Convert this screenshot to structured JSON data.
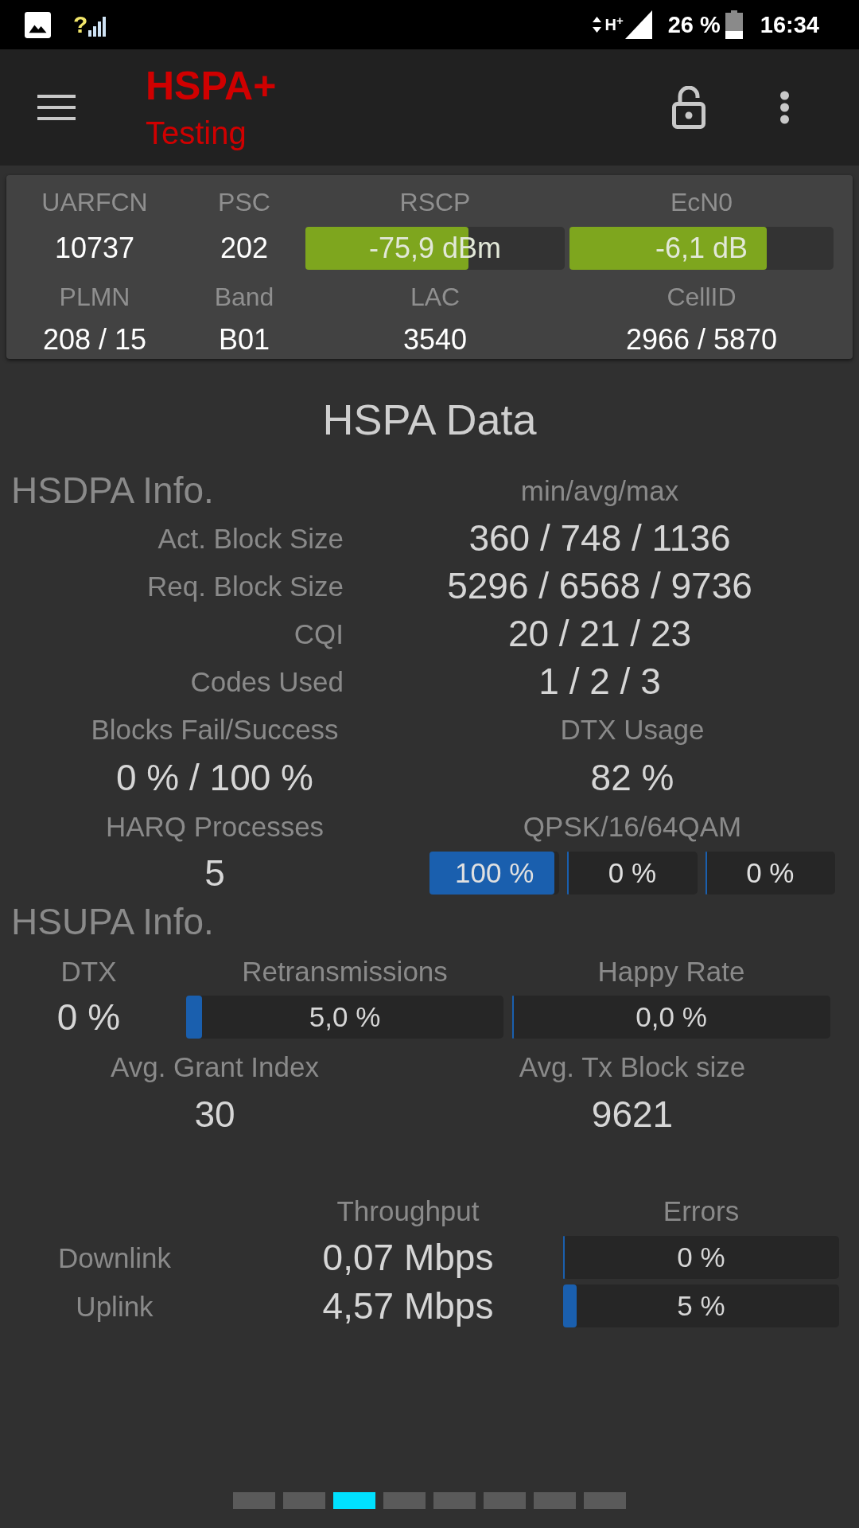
{
  "status_bar": {
    "no_sim_mark": "?",
    "network_type": "H$^{+}$",
    "battery": "26 %",
    "time": "16:34"
  },
  "app_bar": {
    "title": "HSPA+",
    "subtitle": "Testing"
  },
  "cell_info": {
    "fields": [
      {
        "label": "UARFCN",
        "value": "10737",
        "kind": "text"
      },
      {
        "label": "PSC",
        "value": "202",
        "kind": "text"
      },
      {
        "label": "RSCP",
        "value": "-75,9 dBm",
        "kind": "meter",
        "level": 0.64
      },
      {
        "label": "EcN0",
        "value": "-6,1 dB",
        "kind": "meter",
        "level": 0.76
      },
      {
        "label": "PLMN",
        "value": "208 / 15",
        "kind": "text"
      },
      {
        "label": "Band",
        "value": "B01",
        "kind": "text"
      },
      {
        "label": "LAC",
        "value": "3540",
        "kind": "text"
      },
      {
        "label": "CellID",
        "value": "2966 / 5870",
        "kind": "text"
      }
    ]
  },
  "section_title": "HSPA Data",
  "hsdpa": {
    "heading": "HSDPA Info.",
    "column_heading": "min/avg/max",
    "rows": [
      {
        "label": "Act. Block Size",
        "value": "360 / 748 / 1136"
      },
      {
        "label": "Req. Block Size",
        "value": "5296 / 6568 / 9736"
      },
      {
        "label": "CQI",
        "value": "20 / 21 / 23"
      },
      {
        "label": "Codes Used",
        "value": "1 / 2 / 3"
      }
    ],
    "stats": [
      {
        "label": "Blocks Fail/Success",
        "value": "0 % / 100 %"
      },
      {
        "label": "DTX Usage",
        "value": "82 %"
      }
    ],
    "harq": {
      "label": "HARQ Processes",
      "value": "5"
    },
    "modulation": {
      "label": "QPSK/16/64QAM",
      "bars": [
        {
          "reading": "100 %",
          "level": 1
        },
        {
          "reading": "0 %",
          "level": 0
        },
        {
          "reading": "0 %",
          "level": 0
        }
      ]
    }
  },
  "hsupa": {
    "heading": "HSUPA Info.",
    "dtx": {
      "label": "DTX",
      "value": "0 %"
    },
    "meters": [
      {
        "label": "Retransmissions",
        "reading": "5,0 %",
        "level": 0.05
      },
      {
        "label": "Happy Rate",
        "reading": "0,0 %",
        "level": 0
      }
    ],
    "stats": [
      {
        "label": "Avg. Grant Index",
        "value": "30"
      },
      {
        "label": "Avg. Tx Block size",
        "value": "9621"
      }
    ]
  },
  "throughput": {
    "columns": [
      "Throughput",
      "Errors"
    ],
    "rows": [
      {
        "label": "Downlink",
        "value": "0,07 Mbps",
        "error": "0 %",
        "level": 0
      },
      {
        "label": "Uplink",
        "value": "4,57 Mbps",
        "error": "5 %",
        "level": 0.05
      }
    ]
  },
  "pager": [
    {
      "selected": false
    },
    {
      "selected": false
    },
    {
      "selected": true
    },
    {
      "selected": false
    },
    {
      "selected": false
    },
    {
      "selected": false
    },
    {
      "selected": false
    },
    {
      "selected": false
    }
  ]
}
